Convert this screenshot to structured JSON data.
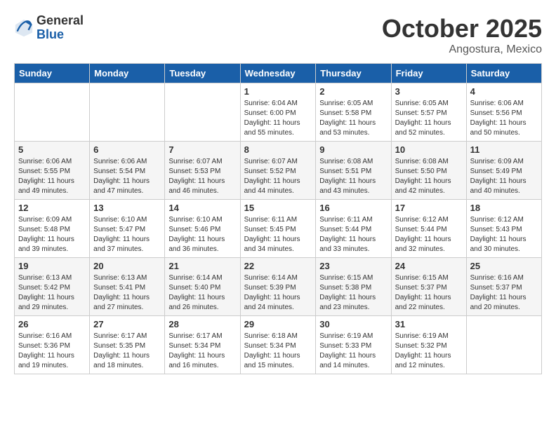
{
  "header": {
    "logo_general": "General",
    "logo_blue": "Blue",
    "month_title": "October 2025",
    "subtitle": "Angostura, Mexico"
  },
  "days_of_week": [
    "Sunday",
    "Monday",
    "Tuesday",
    "Wednesday",
    "Thursday",
    "Friday",
    "Saturday"
  ],
  "weeks": [
    [
      {
        "day": "",
        "info": ""
      },
      {
        "day": "",
        "info": ""
      },
      {
        "day": "",
        "info": ""
      },
      {
        "day": "1",
        "info": "Sunrise: 6:04 AM\nSunset: 6:00 PM\nDaylight: 11 hours and 55 minutes."
      },
      {
        "day": "2",
        "info": "Sunrise: 6:05 AM\nSunset: 5:58 PM\nDaylight: 11 hours and 53 minutes."
      },
      {
        "day": "3",
        "info": "Sunrise: 6:05 AM\nSunset: 5:57 PM\nDaylight: 11 hours and 52 minutes."
      },
      {
        "day": "4",
        "info": "Sunrise: 6:06 AM\nSunset: 5:56 PM\nDaylight: 11 hours and 50 minutes."
      }
    ],
    [
      {
        "day": "5",
        "info": "Sunrise: 6:06 AM\nSunset: 5:55 PM\nDaylight: 11 hours and 49 minutes."
      },
      {
        "day": "6",
        "info": "Sunrise: 6:06 AM\nSunset: 5:54 PM\nDaylight: 11 hours and 47 minutes."
      },
      {
        "day": "7",
        "info": "Sunrise: 6:07 AM\nSunset: 5:53 PM\nDaylight: 11 hours and 46 minutes."
      },
      {
        "day": "8",
        "info": "Sunrise: 6:07 AM\nSunset: 5:52 PM\nDaylight: 11 hours and 44 minutes."
      },
      {
        "day": "9",
        "info": "Sunrise: 6:08 AM\nSunset: 5:51 PM\nDaylight: 11 hours and 43 minutes."
      },
      {
        "day": "10",
        "info": "Sunrise: 6:08 AM\nSunset: 5:50 PM\nDaylight: 11 hours and 42 minutes."
      },
      {
        "day": "11",
        "info": "Sunrise: 6:09 AM\nSunset: 5:49 PM\nDaylight: 11 hours and 40 minutes."
      }
    ],
    [
      {
        "day": "12",
        "info": "Sunrise: 6:09 AM\nSunset: 5:48 PM\nDaylight: 11 hours and 39 minutes."
      },
      {
        "day": "13",
        "info": "Sunrise: 6:10 AM\nSunset: 5:47 PM\nDaylight: 11 hours and 37 minutes."
      },
      {
        "day": "14",
        "info": "Sunrise: 6:10 AM\nSunset: 5:46 PM\nDaylight: 11 hours and 36 minutes."
      },
      {
        "day": "15",
        "info": "Sunrise: 6:11 AM\nSunset: 5:45 PM\nDaylight: 11 hours and 34 minutes."
      },
      {
        "day": "16",
        "info": "Sunrise: 6:11 AM\nSunset: 5:44 PM\nDaylight: 11 hours and 33 minutes."
      },
      {
        "day": "17",
        "info": "Sunrise: 6:12 AM\nSunset: 5:44 PM\nDaylight: 11 hours and 32 minutes."
      },
      {
        "day": "18",
        "info": "Sunrise: 6:12 AM\nSunset: 5:43 PM\nDaylight: 11 hours and 30 minutes."
      }
    ],
    [
      {
        "day": "19",
        "info": "Sunrise: 6:13 AM\nSunset: 5:42 PM\nDaylight: 11 hours and 29 minutes."
      },
      {
        "day": "20",
        "info": "Sunrise: 6:13 AM\nSunset: 5:41 PM\nDaylight: 11 hours and 27 minutes."
      },
      {
        "day": "21",
        "info": "Sunrise: 6:14 AM\nSunset: 5:40 PM\nDaylight: 11 hours and 26 minutes."
      },
      {
        "day": "22",
        "info": "Sunrise: 6:14 AM\nSunset: 5:39 PM\nDaylight: 11 hours and 24 minutes."
      },
      {
        "day": "23",
        "info": "Sunrise: 6:15 AM\nSunset: 5:38 PM\nDaylight: 11 hours and 23 minutes."
      },
      {
        "day": "24",
        "info": "Sunrise: 6:15 AM\nSunset: 5:37 PM\nDaylight: 11 hours and 22 minutes."
      },
      {
        "day": "25",
        "info": "Sunrise: 6:16 AM\nSunset: 5:37 PM\nDaylight: 11 hours and 20 minutes."
      }
    ],
    [
      {
        "day": "26",
        "info": "Sunrise: 6:16 AM\nSunset: 5:36 PM\nDaylight: 11 hours and 19 minutes."
      },
      {
        "day": "27",
        "info": "Sunrise: 6:17 AM\nSunset: 5:35 PM\nDaylight: 11 hours and 18 minutes."
      },
      {
        "day": "28",
        "info": "Sunrise: 6:17 AM\nSunset: 5:34 PM\nDaylight: 11 hours and 16 minutes."
      },
      {
        "day": "29",
        "info": "Sunrise: 6:18 AM\nSunset: 5:34 PM\nDaylight: 11 hours and 15 minutes."
      },
      {
        "day": "30",
        "info": "Sunrise: 6:19 AM\nSunset: 5:33 PM\nDaylight: 11 hours and 14 minutes."
      },
      {
        "day": "31",
        "info": "Sunrise: 6:19 AM\nSunset: 5:32 PM\nDaylight: 11 hours and 12 minutes."
      },
      {
        "day": "",
        "info": ""
      }
    ]
  ]
}
